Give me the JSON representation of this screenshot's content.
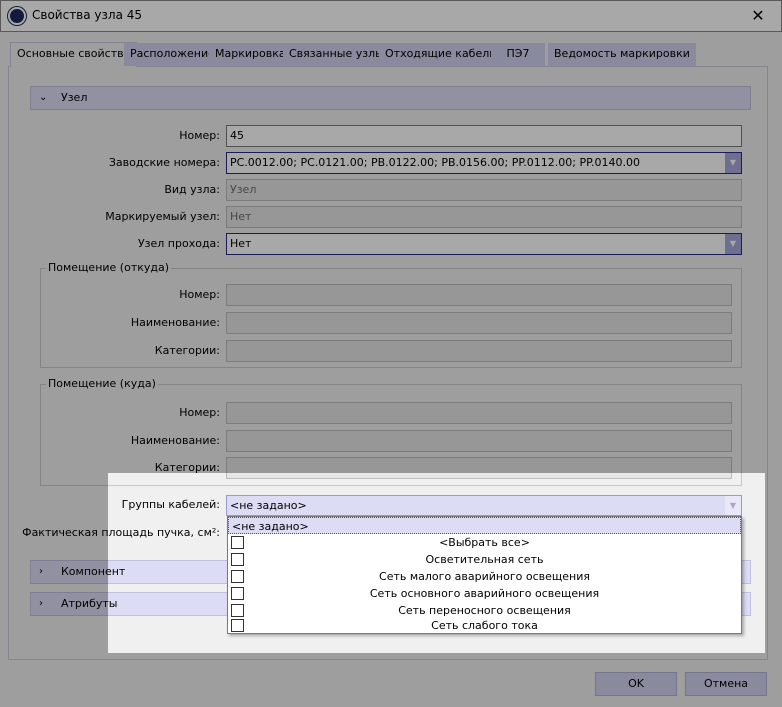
{
  "window": {
    "title": "Свойства узла 45",
    "close_icon": "close-icon"
  },
  "tabs": [
    "Основные свойства",
    "Расположение",
    "Маркировка",
    "Связанные узлы",
    "Отходящие кабели",
    "ПЭ7",
    "Ведомость маркировки"
  ],
  "sections": {
    "node": "Узел",
    "component": "Компонент",
    "attributes": "Атрибуты"
  },
  "fields": {
    "number": {
      "label": "Номер:",
      "value": "45"
    },
    "factory": {
      "label": "Заводские номера:",
      "value": "PC.0012.00; PC.0121.00; PB.0122.00; PB.0156.00; PP.0112.00; PP.0140.00"
    },
    "kind": {
      "label": "Вид узла:",
      "value": "Узел"
    },
    "marked": {
      "label": "Маркируемый узел:",
      "value": "Нет"
    },
    "pass": {
      "label": "Узел прохода:",
      "value": "Нет"
    },
    "groups": {
      "label": "Группы кабелей:",
      "value": "<не задано>"
    },
    "area": {
      "label": "Фактическая площадь пучка, см²:"
    }
  },
  "room_from": {
    "title": "Помещение (откуда)",
    "number": "Номер:",
    "name": "Наименование:",
    "category": "Категории:"
  },
  "room_to": {
    "title": "Помещение (куда)",
    "number": "Номер:",
    "name": "Наименование:",
    "category": "Категории:"
  },
  "dropdown": {
    "selected": "<не задано>",
    "items": [
      "<Выбрать все>",
      "Осветительная сеть",
      "Сеть малого аварийного освещения",
      "Сеть основного аварийного освещения",
      "Сеть переносного освещения",
      "Сеть слабого тока"
    ]
  },
  "buttons": {
    "ok": "OK",
    "cancel": "Отмена"
  }
}
